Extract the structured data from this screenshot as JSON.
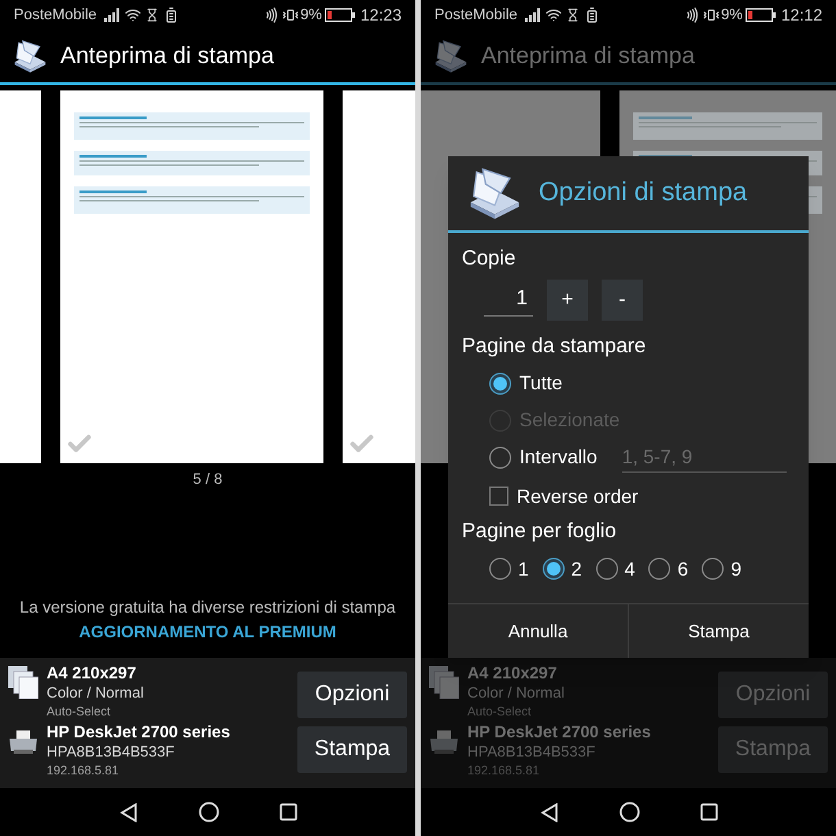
{
  "screens": [
    {
      "dimmed": false,
      "status_bar": {
        "carrier": "PosteMobile",
        "battery": "9%",
        "time": "12:23"
      },
      "title": "Anteprima di stampa",
      "page_counter": "5 / 8",
      "notice": "La versione gratuita ha diverse restrizioni di stampa",
      "upgrade_link": "AGGIORNAMENTO AL PREMIUM",
      "paper": {
        "size": "A4 210x297",
        "mode": "Color / Normal",
        "source": "Auto-Select"
      },
      "printer": {
        "name": "HP DeskJet 2700 series",
        "id": "HPA8B13B4B533F",
        "address": "192.168.5.81"
      },
      "buttons": [
        "Opzioni",
        "Stampa"
      ]
    },
    {
      "dimmed": true,
      "status_bar": {
        "carrier": "PosteMobile",
        "battery": "9%",
        "time": "12:12"
      },
      "title": "Anteprima di stampa",
      "paper": {
        "size": "A4 210x297",
        "mode": "Color / Normal",
        "source": "Auto-Select"
      },
      "printer": {
        "name": "HP DeskJet 2700 series",
        "id": "HPA8B13B4B533F",
        "address": "192.168.5.81"
      },
      "buttons": [
        "Opzioni",
        "Stampa"
      ],
      "dialog": {
        "title": "Opzioni di stampa",
        "copies_label": "Copie",
        "copies_value": "1",
        "increment": "+",
        "decrement": "-",
        "pages_label": "Pagine da stampare",
        "page_options": [
          {
            "label": "Tutte",
            "selected": true,
            "disabled": false
          },
          {
            "label": "Selezionate",
            "selected": false,
            "disabled": true
          },
          {
            "label": "Intervallo",
            "selected": false,
            "disabled": false,
            "placeholder": "1, 5-7, 9"
          }
        ],
        "reverse_order": {
          "label": "Reverse order",
          "checked": false
        },
        "per_sheet_label": "Pagine per foglio",
        "per_sheet_options": [
          {
            "label": "1",
            "selected": false
          },
          {
            "label": "2",
            "selected": true
          },
          {
            "label": "4",
            "selected": false
          },
          {
            "label": "6",
            "selected": false
          },
          {
            "label": "9",
            "selected": false
          }
        ],
        "actions": [
          "Annulla",
          "Stampa"
        ]
      }
    }
  ]
}
